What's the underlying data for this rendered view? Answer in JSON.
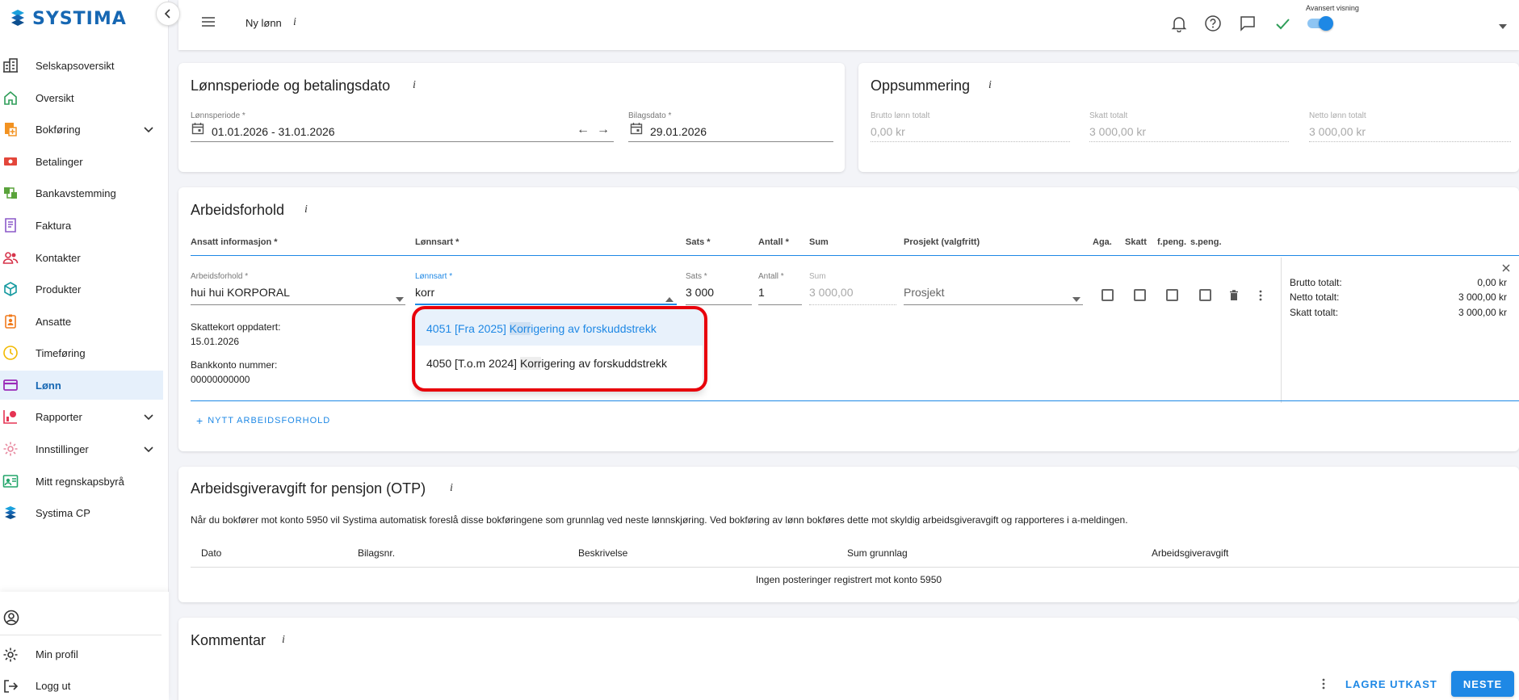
{
  "app": {
    "logo": "SYSTIMA"
  },
  "sidebar": {
    "items": [
      {
        "label": "Selskapsoversikt",
        "icon": "company-icon",
        "color": "#333"
      },
      {
        "label": "Oversikt",
        "icon": "home-icon",
        "color": "#2e9d58"
      },
      {
        "label": "Bokføring",
        "icon": "bookkeeping-icon",
        "color": "#f29221",
        "expandable": true
      },
      {
        "label": "Betalinger",
        "icon": "payments-icon",
        "color": "#e3463a"
      },
      {
        "label": "Bankavstemming",
        "icon": "bank-reconcile-icon",
        "color": "#5aa33b"
      },
      {
        "label": "Faktura",
        "icon": "invoice-icon",
        "color": "#8c59c9"
      },
      {
        "label": "Kontakter",
        "icon": "contacts-icon",
        "color": "#d6334a"
      },
      {
        "label": "Produkter",
        "icon": "products-icon",
        "color": "#159aa0"
      },
      {
        "label": "Ansatte",
        "icon": "employees-icon",
        "color": "#f07a1c"
      },
      {
        "label": "Timeføring",
        "icon": "clock-icon",
        "color": "#f2b900"
      },
      {
        "label": "Lønn",
        "icon": "payroll-icon",
        "color": "#9b2ab8",
        "active": true
      },
      {
        "label": "Rapporter",
        "icon": "reports-icon",
        "color": "#e53353",
        "expandable": true
      },
      {
        "label": "Innstillinger",
        "icon": "settings-icon",
        "color": "#e88aa0",
        "expandable": true
      },
      {
        "label": "Mitt regnskapsbyrå",
        "icon": "accountant-icon",
        "color": "#22a56a"
      },
      {
        "label": "Systima CP",
        "icon": "systima-cp-icon",
        "color": "#1667b3"
      }
    ],
    "bottom": {
      "profile_label": "Min profil",
      "logout_label": "Logg ut"
    }
  },
  "topbar": {
    "title": "Ny lønn",
    "info": "i",
    "toggle_label": "Avansert visning",
    "toggle_on": true
  },
  "period_card": {
    "title": "Lønnsperiode og betalingsdato",
    "period_label": "Lønnsperiode *",
    "period_value": "01.01.2026 - 31.01.2026",
    "date_label": "Bilagsdato *",
    "date_value": "29.01.2026"
  },
  "summary_card": {
    "title": "Oppsummering",
    "fields": [
      {
        "label": "Brutto lønn totalt",
        "value": "0,00 kr"
      },
      {
        "label": "Skatt totalt",
        "value": "3 000,00 kr"
      },
      {
        "label": "Netto lønn totalt",
        "value": "3 000,00 kr"
      }
    ]
  },
  "employment_card": {
    "title": "Arbeidsforhold",
    "headers": [
      "Ansatt informasjon *",
      "Lønnsart *",
      "Sats *",
      "Antall *",
      "Sum",
      "Prosjekt (valgfritt)",
      "Aga.",
      "Skatt",
      "f.peng.",
      "s.peng."
    ],
    "row": {
      "employment_label": "Arbeidsforhold *",
      "employment_value": "hui hui KORPORAL",
      "wage_label": "Lønnsart *",
      "wage_value": "korr",
      "rate_label": "Sats *",
      "rate_value": "3 000",
      "qty_label": "Antall *",
      "qty_value": "1",
      "sum_label": "Sum",
      "sum_value": "3 000,00",
      "project_placeholder": "Prosjekt",
      "tax_card_label": "Skattekort oppdatert:",
      "tax_card_date": "15.01.2026",
      "bank_label": "Bankkonto nummer:",
      "bank_value": "00000000000"
    },
    "totals": [
      {
        "label": "Brutto totalt:",
        "value": "0,00 kr"
      },
      {
        "label": "Netto totalt:",
        "value": "3 000,00 kr"
      },
      {
        "label": "Skatt totalt:",
        "value": "3 000,00 kr"
      }
    ],
    "add_button": "NYTT ARBEIDSFORHOLD",
    "dropdown": [
      {
        "code": "4051 [Fra 2025] ",
        "match": "Korr",
        "rest": "igering av forskuddstrekk",
        "highlighted": true
      },
      {
        "code": "4050 [T.o.m 2024] ",
        "match": "Korr",
        "rest": "igering av forskuddstrekk",
        "highlighted": false
      }
    ]
  },
  "otp_card": {
    "title": "Arbeidsgiveravgift for pensjon (OTP)",
    "description": "Når du bokfører mot konto 5950 vil Systima automatisk foreslå disse bokføringene som grunnlag ved neste lønnskjøring. Ved bokføring av lønn bokføres dette mot skyldig arbeidsgiveravgift og rapporteres i a-meldingen.",
    "headers": [
      "Dato",
      "Bilagsnr.",
      "Beskrivelse",
      "Sum grunnlag",
      "Arbeidsgiveravgift"
    ],
    "empty": "Ingen posteringer registrert mot konto 5950"
  },
  "comment_card": {
    "title": "Kommentar"
  },
  "footer": {
    "draft_label": "LAGRE UTKAST",
    "next_label": "NESTE"
  },
  "colors": {
    "primary": "#1e88e5",
    "annotation": "#e8000b"
  }
}
